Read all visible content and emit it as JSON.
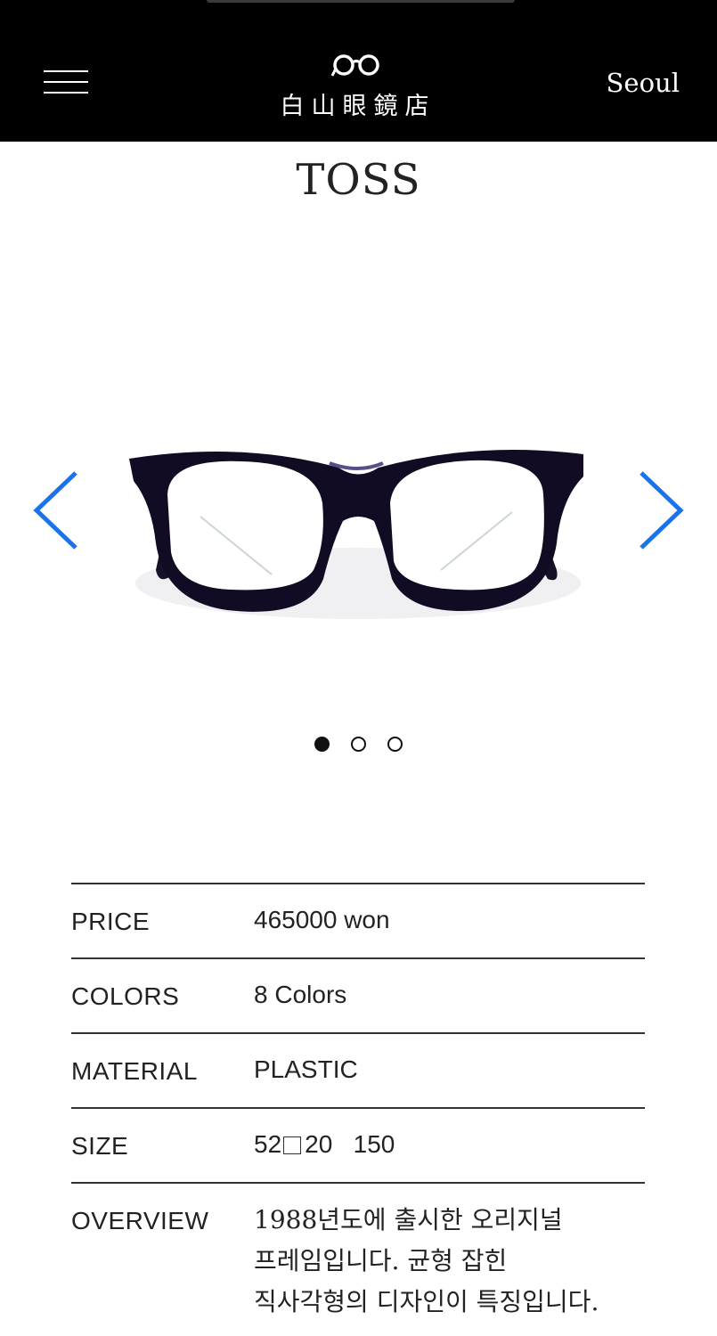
{
  "header": {
    "brand_name": "白山眼鏡店",
    "city": "Seoul",
    "menu_icon": "hamburger-menu-icon",
    "logo_icon": "glasses-logo-icon",
    "background": "#000000"
  },
  "product": {
    "name": "TOSS",
    "carousel": {
      "prev_icon": "chevron-left-icon",
      "next_icon": "chevron-right-icon",
      "arrow_color": "#1a73e8",
      "image": "black-acetate-eyeglasses",
      "dot_count": 3,
      "active_dot": 1
    },
    "specs": [
      {
        "label": "PRICE",
        "value": "465000 won"
      },
      {
        "label": "COLORS",
        "value": "8 Colors"
      },
      {
        "label": "MATERIAL",
        "value": "PLASTIC"
      },
      {
        "label": "SIZE",
        "lens": "52",
        "bridge": "20",
        "temple": "150"
      }
    ],
    "overview": {
      "label": "OVERVIEW",
      "lines": [
        "1988년도에 출시한 오리지널",
        "프레임입니다. 균형 잡힌",
        "직사각형의 디자인이 특징입니다."
      ]
    }
  }
}
